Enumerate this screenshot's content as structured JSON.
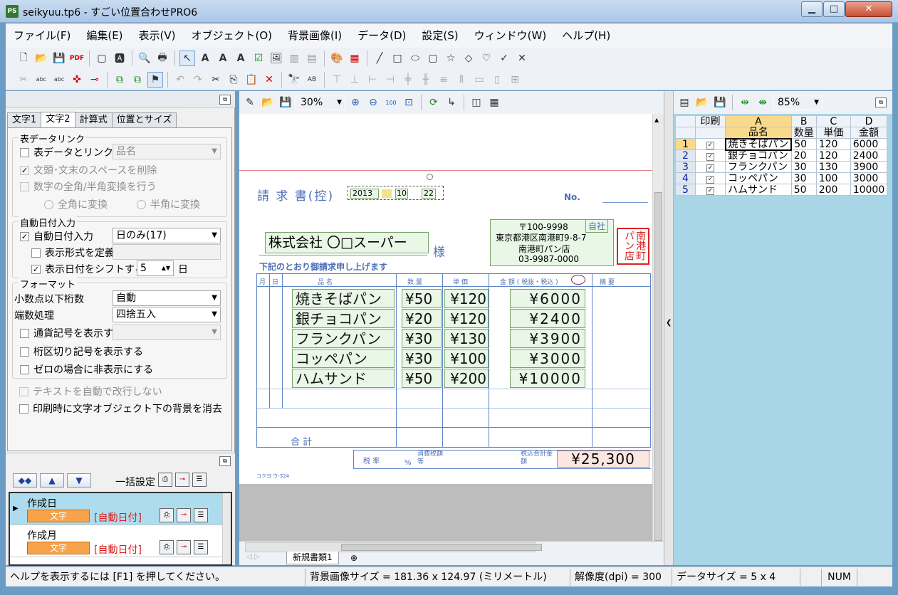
{
  "window": {
    "title": "seikyuu.tp6 - すごい位置合わせPRO6",
    "app_icon": "PS",
    "min": "▁",
    "max": "□",
    "close": "✕"
  },
  "menu": [
    "ファイル(F)",
    "編集(E)",
    "表示(V)",
    "オブジェクト(O)",
    "背景画像(I)",
    "データ(D)",
    "設定(S)",
    "ウィンドウ(W)",
    "ヘルプ(H)"
  ],
  "left": {
    "tabs": [
      "文字1",
      "文字2",
      "計算式",
      "位置とサイズ"
    ],
    "active_tab": "文字2",
    "table_link": {
      "group": "表データリンク",
      "link_label": "表データとリンク",
      "link_combo": "品名",
      "trim_label": "文頭･文末のスペースを削除",
      "convert_label": "数字の全角/半角変換を行う",
      "to_full": "全角に変換",
      "to_half": "半角に変換"
    },
    "auto_date": {
      "group": "自動日付入力",
      "enable_label": "自動日付入力",
      "mode": "日のみ(17)",
      "format_label": "表示形式を定義",
      "shift_label": "表示日付をシフトする",
      "shift_value": "5",
      "shift_unit": "日"
    },
    "format": {
      "group": "フォーマット",
      "decimal_label": "小数点以下桁数",
      "decimal_value": "自動",
      "round_label": "端数処理",
      "round_value": "四捨五入",
      "currency_label": "通貨記号を表示する",
      "sep_label": "桁区切り記号を表示する",
      "zero_label": "ゼロの場合に非表示にする"
    },
    "no_wrap_label": "テキストを自動で改行しない",
    "erase_bg_label": "印刷時に文字オブジェクト下の背景を消去",
    "bulk_label": "一括設定",
    "fields": [
      {
        "name": "作成日",
        "tag": "文字",
        "sub": "[自動日付]"
      },
      {
        "name": "作成月",
        "tag": "文字",
        "sub": "[自動日付]"
      }
    ]
  },
  "canvas": {
    "zoom": "30%",
    "sheet_tab": "新規書類1",
    "doc": {
      "title": "請 求 書(控)",
      "year": "2013",
      "month": "10",
      "day": "22",
      "no_label": "No.",
      "customer": "株式会社 〇□スーパー",
      "sama": "様",
      "zip": "〒100-9998",
      "jisha": "自社",
      "address": "東京都港区南港町9-8-7",
      "store": "南港町パン店",
      "tel": "03-9987-0000",
      "stamp": "南港町パン店",
      "notice": "下記のとおり御請求申し上げます",
      "headers": [
        "月",
        "日",
        "品 名",
        "数 量",
        "単 価",
        "金 額 ( 税抜・税込 )",
        "摘 要"
      ],
      "rows": [
        {
          "name": "焼きそばパン",
          "qty": "¥50",
          "price": "¥120",
          "amount": "¥6000"
        },
        {
          "name": "銀チョコパン",
          "qty": "¥20",
          "price": "¥120",
          "amount": "¥2400"
        },
        {
          "name": "フランクパン",
          "qty": "¥30",
          "price": "¥130",
          "amount": "¥3900"
        },
        {
          "name": "コッペパン",
          "qty": "¥30",
          "price": "¥100",
          "amount": "¥3000"
        },
        {
          "name": "ハムサンド",
          "qty": "¥50",
          "price": "¥200",
          "amount": "¥10000"
        }
      ],
      "total_label": "合 計",
      "tax_rate": "税 率",
      "tax_amount": "消費税額 等",
      "pct": "%",
      "taxin_total_label": "税込合計金額",
      "grand_total": "¥25,300",
      "footer": "コクヨ ウ-324"
    }
  },
  "right": {
    "zoom": "85%",
    "columns": [
      "印刷",
      "A",
      "B",
      "C",
      "D"
    ],
    "headers": [
      "",
      "品名",
      "数量",
      "単価",
      "金額"
    ],
    "rows": [
      {
        "n": "1",
        "name": "焼きそばパン",
        "b": "50",
        "c": "120",
        "d": "6000"
      },
      {
        "n": "2",
        "name": "銀チョコパン",
        "b": "20",
        "c": "120",
        "d": "2400"
      },
      {
        "n": "3",
        "name": "フランクパン",
        "b": "30",
        "c": "130",
        "d": "3900"
      },
      {
        "n": "4",
        "name": "コッペパン",
        "b": "30",
        "c": "100",
        "d": "3000"
      },
      {
        "n": "5",
        "name": "ハムサンド",
        "b": "50",
        "c": "200",
        "d": "10000"
      }
    ]
  },
  "status": {
    "help": "ヘルプを表示するには [F1] を押してください。",
    "bgsize": "背景画像サイズ = 181.36 x 124.97 (ミリメートル)",
    "dpi": "解像度(dpi) = 300",
    "datasize": "データサイズ = 5 x 4",
    "num": "NUM"
  }
}
